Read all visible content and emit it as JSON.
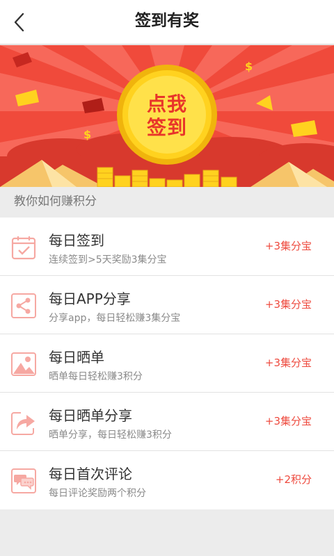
{
  "header": {
    "title": "签到有奖"
  },
  "banner": {
    "button_line1": "点我",
    "button_line2": "签到"
  },
  "section": {
    "label": "教你如何赚积分"
  },
  "tasks": [
    {
      "icon": "calendar-check-icon",
      "name": "每日签到",
      "desc": "连续签到>5天奖励3集分宝",
      "reward": "+3集分宝"
    },
    {
      "icon": "share-icon",
      "name": "每日APP分享",
      "desc": "分享app，每日轻松赚3集分宝",
      "reward": "+3集分宝"
    },
    {
      "icon": "image-icon",
      "name": "每日晒单",
      "desc": "晒单每日轻松赚3积分",
      "reward": "+3集分宝"
    },
    {
      "icon": "forward-arrow-icon",
      "name": "每日晒单分享",
      "desc": "晒单分享，每日轻松赚3积分",
      "reward": "+3集分宝"
    },
    {
      "icon": "comment-icon",
      "name": "每日首次评论",
      "desc": "每日评论奖励两个积分",
      "reward": "+2积分"
    }
  ],
  "colors": {
    "accent": "#ee4a3e",
    "banner": "#f04a3b",
    "coin": "#ffd21f",
    "icon": "#f6a8a2"
  }
}
